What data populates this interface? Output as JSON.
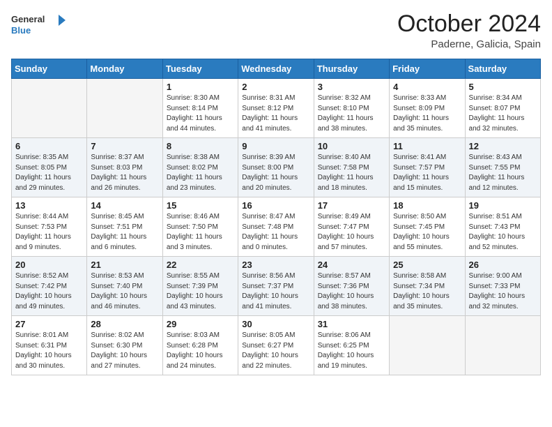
{
  "header": {
    "logo_general": "General",
    "logo_blue": "Blue",
    "month_year": "October 2024",
    "location": "Paderne, Galicia, Spain"
  },
  "days_of_week": [
    "Sunday",
    "Monday",
    "Tuesday",
    "Wednesday",
    "Thursday",
    "Friday",
    "Saturday"
  ],
  "weeks": [
    [
      {
        "day": "",
        "sunrise": "",
        "sunset": "",
        "daylight": ""
      },
      {
        "day": "",
        "sunrise": "",
        "sunset": "",
        "daylight": ""
      },
      {
        "day": "1",
        "sunrise": "Sunrise: 8:30 AM",
        "sunset": "Sunset: 8:14 PM",
        "daylight": "Daylight: 11 hours and 44 minutes."
      },
      {
        "day": "2",
        "sunrise": "Sunrise: 8:31 AM",
        "sunset": "Sunset: 8:12 PM",
        "daylight": "Daylight: 11 hours and 41 minutes."
      },
      {
        "day": "3",
        "sunrise": "Sunrise: 8:32 AM",
        "sunset": "Sunset: 8:10 PM",
        "daylight": "Daylight: 11 hours and 38 minutes."
      },
      {
        "day": "4",
        "sunrise": "Sunrise: 8:33 AM",
        "sunset": "Sunset: 8:09 PM",
        "daylight": "Daylight: 11 hours and 35 minutes."
      },
      {
        "day": "5",
        "sunrise": "Sunrise: 8:34 AM",
        "sunset": "Sunset: 8:07 PM",
        "daylight": "Daylight: 11 hours and 32 minutes."
      }
    ],
    [
      {
        "day": "6",
        "sunrise": "Sunrise: 8:35 AM",
        "sunset": "Sunset: 8:05 PM",
        "daylight": "Daylight: 11 hours and 29 minutes."
      },
      {
        "day": "7",
        "sunrise": "Sunrise: 8:37 AM",
        "sunset": "Sunset: 8:03 PM",
        "daylight": "Daylight: 11 hours and 26 minutes."
      },
      {
        "day": "8",
        "sunrise": "Sunrise: 8:38 AM",
        "sunset": "Sunset: 8:02 PM",
        "daylight": "Daylight: 11 hours and 23 minutes."
      },
      {
        "day": "9",
        "sunrise": "Sunrise: 8:39 AM",
        "sunset": "Sunset: 8:00 PM",
        "daylight": "Daylight: 11 hours and 20 minutes."
      },
      {
        "day": "10",
        "sunrise": "Sunrise: 8:40 AM",
        "sunset": "Sunset: 7:58 PM",
        "daylight": "Daylight: 11 hours and 18 minutes."
      },
      {
        "day": "11",
        "sunrise": "Sunrise: 8:41 AM",
        "sunset": "Sunset: 7:57 PM",
        "daylight": "Daylight: 11 hours and 15 minutes."
      },
      {
        "day": "12",
        "sunrise": "Sunrise: 8:43 AM",
        "sunset": "Sunset: 7:55 PM",
        "daylight": "Daylight: 11 hours and 12 minutes."
      }
    ],
    [
      {
        "day": "13",
        "sunrise": "Sunrise: 8:44 AM",
        "sunset": "Sunset: 7:53 PM",
        "daylight": "Daylight: 11 hours and 9 minutes."
      },
      {
        "day": "14",
        "sunrise": "Sunrise: 8:45 AM",
        "sunset": "Sunset: 7:51 PM",
        "daylight": "Daylight: 11 hours and 6 minutes."
      },
      {
        "day": "15",
        "sunrise": "Sunrise: 8:46 AM",
        "sunset": "Sunset: 7:50 PM",
        "daylight": "Daylight: 11 hours and 3 minutes."
      },
      {
        "day": "16",
        "sunrise": "Sunrise: 8:47 AM",
        "sunset": "Sunset: 7:48 PM",
        "daylight": "Daylight: 11 hours and 0 minutes."
      },
      {
        "day": "17",
        "sunrise": "Sunrise: 8:49 AM",
        "sunset": "Sunset: 7:47 PM",
        "daylight": "Daylight: 10 hours and 57 minutes."
      },
      {
        "day": "18",
        "sunrise": "Sunrise: 8:50 AM",
        "sunset": "Sunset: 7:45 PM",
        "daylight": "Daylight: 10 hours and 55 minutes."
      },
      {
        "day": "19",
        "sunrise": "Sunrise: 8:51 AM",
        "sunset": "Sunset: 7:43 PM",
        "daylight": "Daylight: 10 hours and 52 minutes."
      }
    ],
    [
      {
        "day": "20",
        "sunrise": "Sunrise: 8:52 AM",
        "sunset": "Sunset: 7:42 PM",
        "daylight": "Daylight: 10 hours and 49 minutes."
      },
      {
        "day": "21",
        "sunrise": "Sunrise: 8:53 AM",
        "sunset": "Sunset: 7:40 PM",
        "daylight": "Daylight: 10 hours and 46 minutes."
      },
      {
        "day": "22",
        "sunrise": "Sunrise: 8:55 AM",
        "sunset": "Sunset: 7:39 PM",
        "daylight": "Daylight: 10 hours and 43 minutes."
      },
      {
        "day": "23",
        "sunrise": "Sunrise: 8:56 AM",
        "sunset": "Sunset: 7:37 PM",
        "daylight": "Daylight: 10 hours and 41 minutes."
      },
      {
        "day": "24",
        "sunrise": "Sunrise: 8:57 AM",
        "sunset": "Sunset: 7:36 PM",
        "daylight": "Daylight: 10 hours and 38 minutes."
      },
      {
        "day": "25",
        "sunrise": "Sunrise: 8:58 AM",
        "sunset": "Sunset: 7:34 PM",
        "daylight": "Daylight: 10 hours and 35 minutes."
      },
      {
        "day": "26",
        "sunrise": "Sunrise: 9:00 AM",
        "sunset": "Sunset: 7:33 PM",
        "daylight": "Daylight: 10 hours and 32 minutes."
      }
    ],
    [
      {
        "day": "27",
        "sunrise": "Sunrise: 8:01 AM",
        "sunset": "Sunset: 6:31 PM",
        "daylight": "Daylight: 10 hours and 30 minutes."
      },
      {
        "day": "28",
        "sunrise": "Sunrise: 8:02 AM",
        "sunset": "Sunset: 6:30 PM",
        "daylight": "Daylight: 10 hours and 27 minutes."
      },
      {
        "day": "29",
        "sunrise": "Sunrise: 8:03 AM",
        "sunset": "Sunset: 6:28 PM",
        "daylight": "Daylight: 10 hours and 24 minutes."
      },
      {
        "day": "30",
        "sunrise": "Sunrise: 8:05 AM",
        "sunset": "Sunset: 6:27 PM",
        "daylight": "Daylight: 10 hours and 22 minutes."
      },
      {
        "day": "31",
        "sunrise": "Sunrise: 8:06 AM",
        "sunset": "Sunset: 6:25 PM",
        "daylight": "Daylight: 10 hours and 19 minutes."
      },
      {
        "day": "",
        "sunrise": "",
        "sunset": "",
        "daylight": ""
      },
      {
        "day": "",
        "sunrise": "",
        "sunset": "",
        "daylight": ""
      }
    ]
  ]
}
